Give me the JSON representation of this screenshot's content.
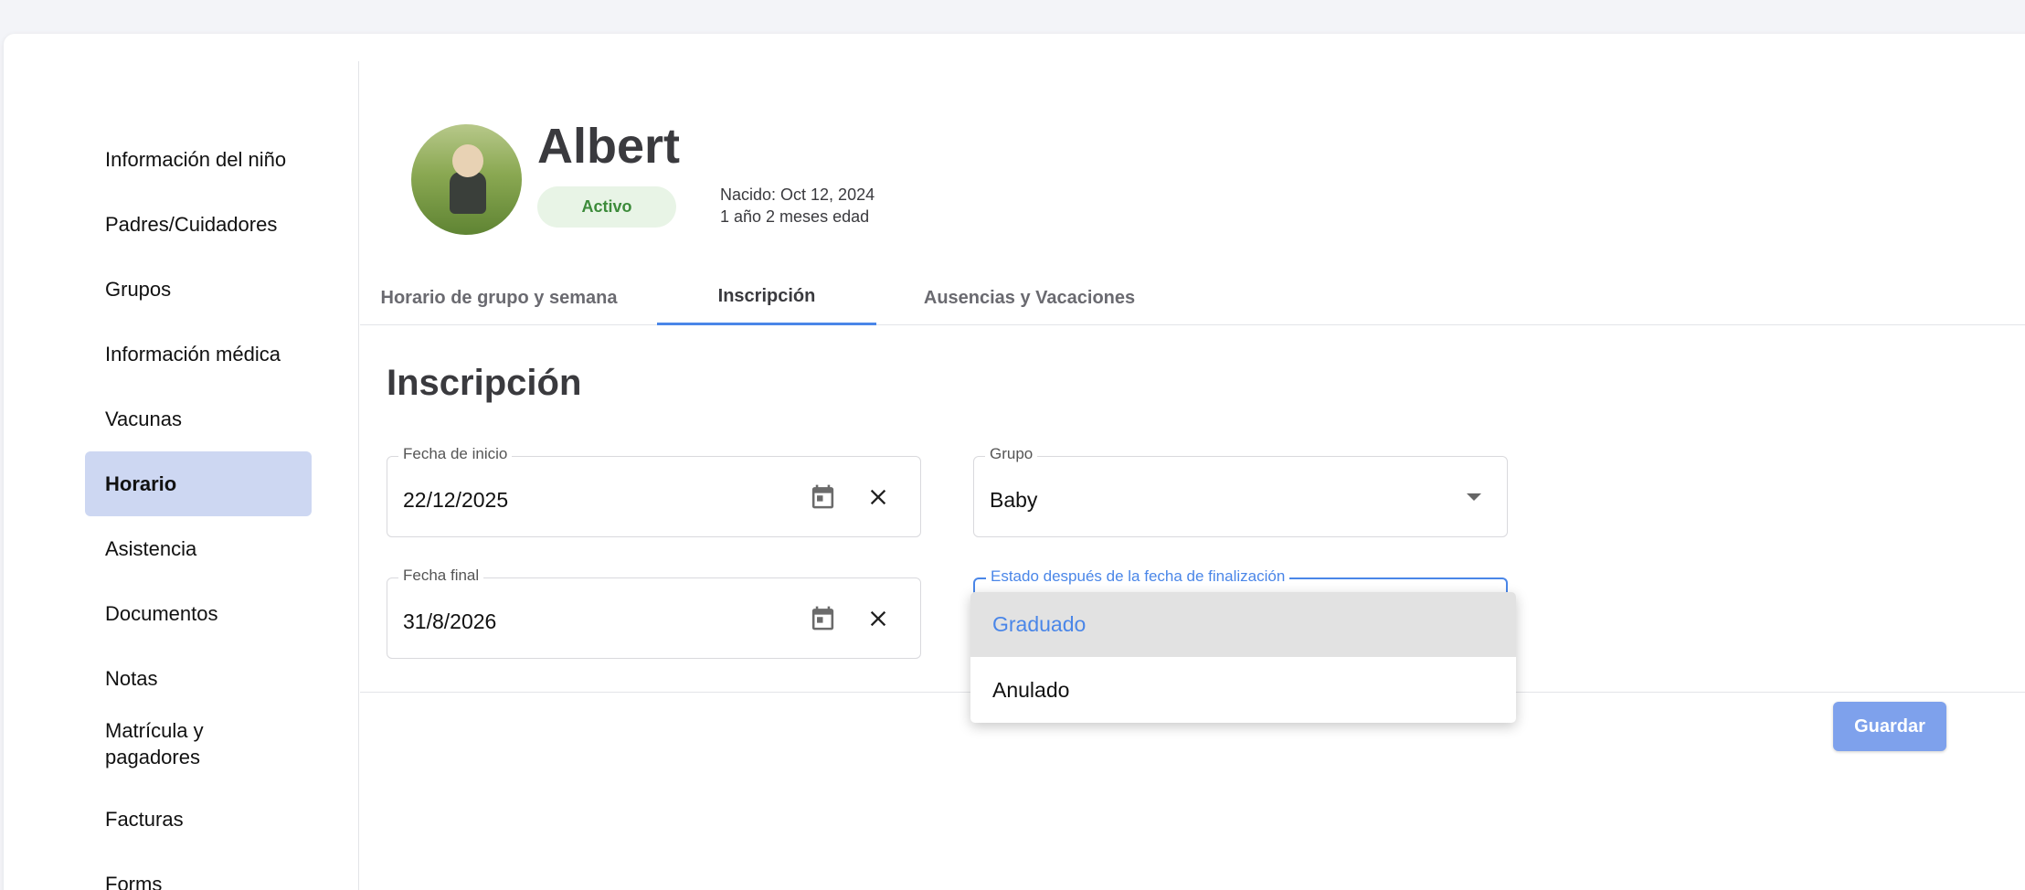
{
  "sidebar": {
    "items": [
      {
        "label": "Información del niño"
      },
      {
        "label": "Padres/Cuidadores"
      },
      {
        "label": "Grupos"
      },
      {
        "label": "Información médica"
      },
      {
        "label": "Vacunas"
      },
      {
        "label": "Horario"
      },
      {
        "label": "Asistencia"
      },
      {
        "label": "Documentos"
      },
      {
        "label": "Notas"
      },
      {
        "label": "Matrícula y pagadores"
      },
      {
        "label": "Facturas"
      },
      {
        "label": "Forms"
      }
    ],
    "active": "Horario"
  },
  "profile": {
    "name": "Albert",
    "status": "Activo",
    "born": "Nacido: Oct 12, 2024",
    "age": "1 año 2 meses edad"
  },
  "tabs": [
    {
      "label": "Horario de grupo y semana"
    },
    {
      "label": "Inscripción"
    },
    {
      "label": "Ausencias y Vacaciones"
    }
  ],
  "active_tab": "Inscripción",
  "section": {
    "title": "Inscripción"
  },
  "form": {
    "start_date": {
      "label": "Fecha de inicio",
      "value": "22/12/2025"
    },
    "end_date": {
      "label": "Fecha final",
      "value": "31/8/2026"
    },
    "group": {
      "label": "Grupo",
      "value": "Baby"
    },
    "status_after": {
      "label": "Estado después de la fecha de finalización"
    }
  },
  "dropdown": {
    "options": [
      {
        "label": "Graduado"
      },
      {
        "label": "Anulado"
      }
    ],
    "highlighted": "Graduado"
  },
  "actions": {
    "save_label": "Guardar"
  },
  "colors": {
    "accent": "#4a86e8",
    "active_nav": "#cdd7f2",
    "status_green": "#3c8b3a",
    "save_button": "#7ea1ec"
  },
  "icons": {
    "date_picker": "calendar-icon",
    "clear": "close-icon",
    "select": "caret-down-icon"
  }
}
